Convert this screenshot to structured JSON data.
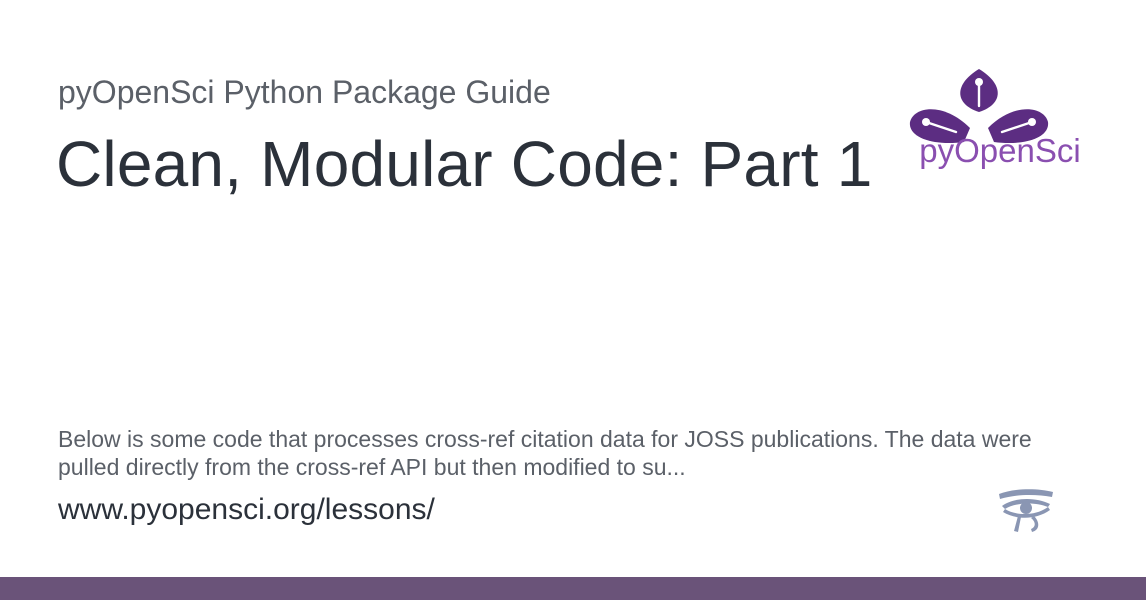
{
  "site": {
    "name": "pyOpenSci Python Package Guide"
  },
  "page": {
    "title": "Clean, Modular Code: Part 1",
    "description": "Below is some code that processes cross-ref citation data for JOSS publications. The data were pulled directly from the cross-ref API but then modified to su...",
    "url": "www.pyopensci.org/lessons/"
  },
  "logo": {
    "text": "pyOpenSci",
    "icon": "pyopensci-flower-logo"
  },
  "icons": {
    "eye": "eye-of-horus-icon"
  },
  "colors": {
    "brand_purple": "#5c2d82",
    "logo_text_purple": "#8a4fb0",
    "bottom_bar": "#6a5379",
    "eye_icon": "#8a96b3",
    "title_text": "#2b313a",
    "muted_text": "#5b6068",
    "background": "#ffffff"
  }
}
